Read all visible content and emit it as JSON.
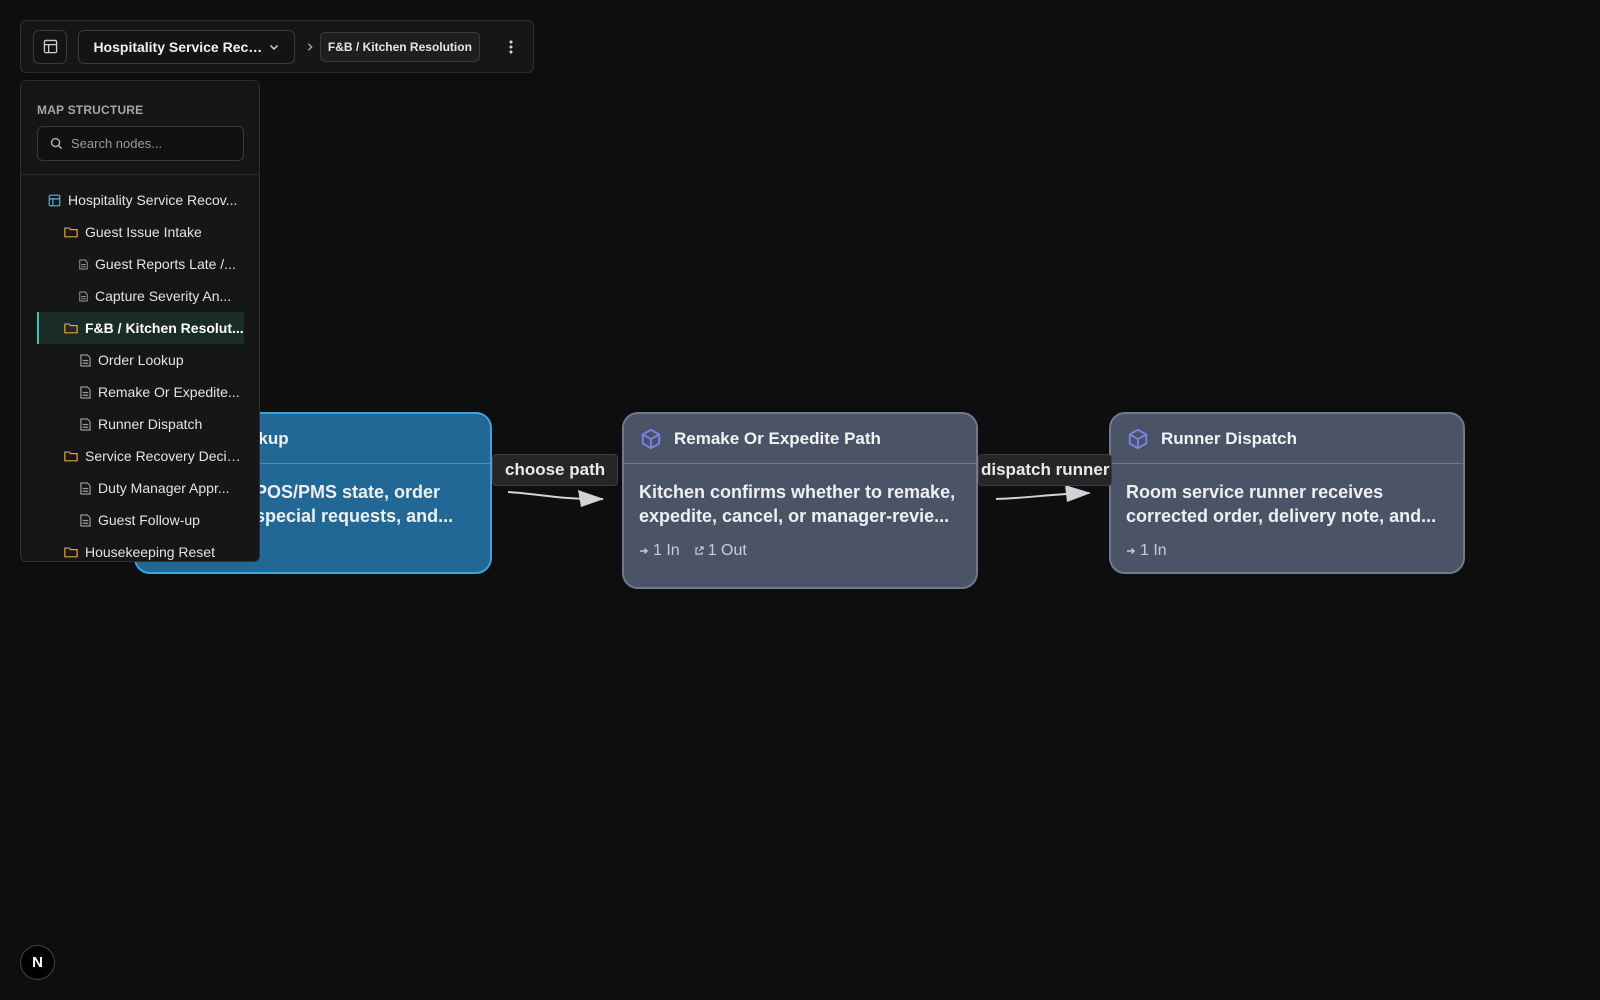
{
  "toolbar": {
    "map_name": "Hospitality Service Reco...",
    "breadcrumb": "F&B / Kitchen Resolution"
  },
  "sidebar": {
    "heading": "MAP STRUCTURE",
    "search_placeholder": "Search nodes...",
    "items": [
      {
        "label": "Hospitality Service Recov...",
        "type": "map",
        "level": 0
      },
      {
        "label": "Guest Issue Intake",
        "type": "folder",
        "level": 1
      },
      {
        "label": "Guest Reports Late /...",
        "type": "doc",
        "level": 2
      },
      {
        "label": "Capture Severity An...",
        "type": "doc",
        "level": 2
      },
      {
        "label": "F&B / Kitchen Resolut...",
        "type": "folder",
        "level": 1,
        "active": true
      },
      {
        "label": "Order Lookup",
        "type": "doc",
        "level": 2
      },
      {
        "label": "Remake Or Expedite...",
        "type": "doc",
        "level": 2
      },
      {
        "label": "Runner Dispatch",
        "type": "doc",
        "level": 2
      },
      {
        "label": "Service Recovery Decis...",
        "type": "folder",
        "level": 1
      },
      {
        "label": "Duty Manager Appr...",
        "type": "doc",
        "level": 2
      },
      {
        "label": "Guest Follow-up",
        "type": "doc",
        "level": 2
      },
      {
        "label": "Housekeeping Reset",
        "type": "folder",
        "level": 1
      }
    ]
  },
  "nodes": {
    "order_lookup": {
      "title": "okup",
      "desc_line1": "POS/PMS state, order",
      "desc_line2": "special requests, and..."
    },
    "remake": {
      "title": "Remake Or Expedite Path",
      "desc_line1": "Kitchen confirms whether to remake,",
      "desc_line2": "expedite, cancel, or manager-revie...",
      "in": "1 In",
      "out": "1 Out"
    },
    "runner": {
      "title": "Runner Dispatch",
      "desc_line1": "Room service runner receives",
      "desc_line2": "corrected order, delivery note, and...",
      "in": "1 In"
    }
  },
  "edges": {
    "choose_path": "choose path",
    "dispatch_runner": "dispatch runner"
  },
  "badge": "N",
  "colors": {
    "background": "#0e0e0f",
    "selected_node": "#226896",
    "node": "#4a5466",
    "active_tree_item": "#3cc2b0",
    "folder_icon": "#e5a13a",
    "cube_icon": "#7b83e8"
  }
}
